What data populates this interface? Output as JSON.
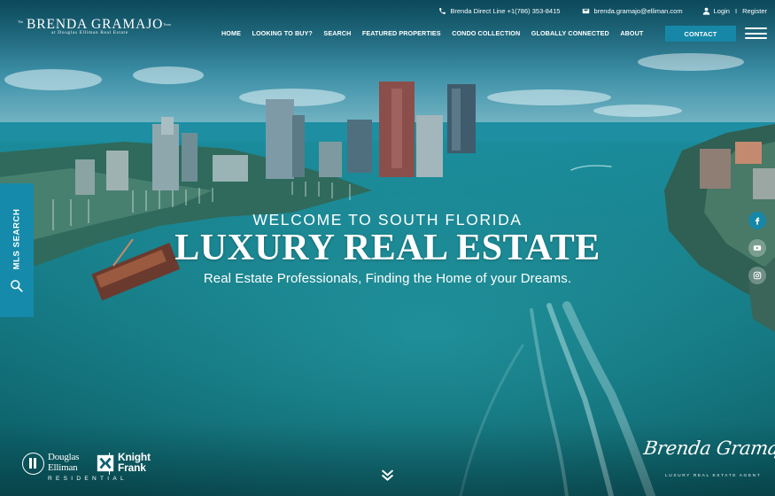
{
  "header": {
    "logo": {
      "prefix": "The",
      "name": "BRENDA GRAMAJO",
      "suffix": "Team",
      "subline": "at Douglas Elliman Real Estate"
    },
    "topbar": {
      "phone": "Brenda Direct Line +1(786) 353-8415",
      "email": "brenda.gramajo@elliman.com",
      "login": "Login",
      "separator": "I",
      "register": "Register"
    },
    "nav": [
      "HOME",
      "LOOKING TO BUY?",
      "SEARCH",
      "FEATURED PROPERTIES",
      "CONDO COLLECTION",
      "GLOBALLY CONNECTED",
      "ABOUT"
    ],
    "contact_label": "CONTACT"
  },
  "sidebar": {
    "mls_label": "MLS SEARCH"
  },
  "hero": {
    "kicker": "WELCOME TO SOUTH FLORIDA",
    "title": "LUXURY REAL ESTATE",
    "subtitle": "Real Estate Professionals, Finding the Home of your Dreams."
  },
  "social": [
    "facebook-icon",
    "youtube-icon",
    "instagram-icon"
  ],
  "footer": {
    "brand": {
      "douglas": "Douglas",
      "elliman": "Elliman",
      "knight": "Knight",
      "frank": "Frank",
      "residential": "RESIDENTIAL"
    },
    "signature": {
      "script": "Brenda Gramajo",
      "tagline": "LUXURY REAL ESTATE AGENT"
    }
  },
  "colors": {
    "accent": "#1687a7",
    "water_deep": "#0b5b6a",
    "water_light": "#1f98a6"
  }
}
